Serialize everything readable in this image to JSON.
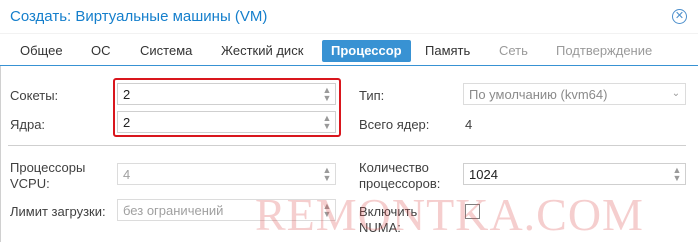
{
  "window": {
    "title": "Создать: Виртуальные машины (VM)"
  },
  "tabs": [
    {
      "label": "Общее",
      "state": "normal"
    },
    {
      "label": "ОС",
      "state": "normal"
    },
    {
      "label": "Система",
      "state": "normal"
    },
    {
      "label": "Жесткий диск",
      "state": "normal"
    },
    {
      "label": "Процессор",
      "state": "active"
    },
    {
      "label": "Память",
      "state": "normal"
    },
    {
      "label": "Сеть",
      "state": "disabled"
    },
    {
      "label": "Подтверждение",
      "state": "disabled"
    }
  ],
  "form": {
    "sockets_label": "Сокеты:",
    "sockets_value": "2",
    "cores_label": "Ядра:",
    "cores_value": "2",
    "type_label": "Тип:",
    "type_value": "По умолчанию (kvm64)",
    "total_cores_label": "Всего ядер:",
    "total_cores_value": "4",
    "vcpu_label_line1": "Процессоры",
    "vcpu_label_line2": "VCPU:",
    "vcpu_value": "4",
    "cpu_count_label_line1": "Количество",
    "cpu_count_label_line2": "процессоров:",
    "cpu_count_value": "1024",
    "load_limit_label": "Лимит загрузки:",
    "load_limit_value": "без ограничений",
    "numa_label_line1": "Включить",
    "numa_label_line2": "NUMA:"
  },
  "watermark": "REMONTKA.COM",
  "colors": {
    "accent": "#3892d3",
    "title": "#157fcc",
    "highlight": "#d9161d"
  }
}
